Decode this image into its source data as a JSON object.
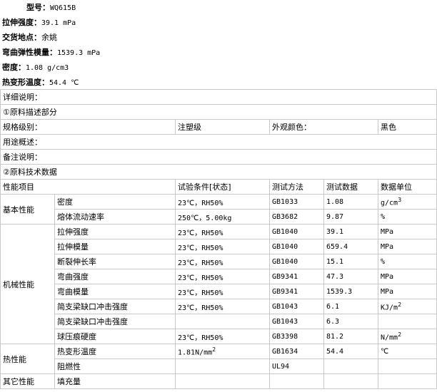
{
  "summary": {
    "model": {
      "label": "型号：",
      "value": "WQ615B"
    },
    "tensile": {
      "label": "拉伸强度：",
      "value": "39.1 mPa"
    },
    "delivery": {
      "label": "交货地点：",
      "value": "余姚"
    },
    "flex_modulus": {
      "label": "弯曲弹性模量：",
      "value": "1539.3 mPa"
    },
    "density": {
      "label": "密度：",
      "value": "1.08 g/cm3"
    },
    "hdt": {
      "label": "热变形温度：",
      "value": "54.4 ℃"
    }
  },
  "details": {
    "heading": "详细说明：",
    "section1": "①原料描述部分",
    "grade_label": "规格级别：",
    "grade_value": "注塑级",
    "color_label": "外观颜色：",
    "color_value": "黑色",
    "usage_label": "用途概述：",
    "note_label": "备注说明：",
    "section2": "②原料技术数据"
  },
  "table": {
    "headers": [
      "性能项目",
      "试验条件[状态]",
      "测试方法",
      "测试数据",
      "数据单位"
    ],
    "groups": [
      {
        "name": "基本性能",
        "rows": [
          {
            "prop": "密度",
            "cond": "23℃，RH50%",
            "method": "GB1033",
            "value": "1.08",
            "unit": "g/cm",
            "sup": "3"
          },
          {
            "prop": "熔体流动速率",
            "cond": "250℃，5.00kg",
            "method": "GB3682",
            "value": "9.87",
            "unit": "%",
            "sup": ""
          }
        ]
      },
      {
        "name": "机械性能",
        "rows": [
          {
            "prop": "拉伸强度",
            "cond": "23℃，RH50%",
            "method": "GB1040",
            "value": "39.1",
            "unit": "MPa",
            "sup": ""
          },
          {
            "prop": "拉伸模量",
            "cond": "23℃，RH50%",
            "method": "GB1040",
            "value": "659.4",
            "unit": "MPa",
            "sup": ""
          },
          {
            "prop": "断裂伸长率",
            "cond": "23℃，RH50%",
            "method": "GB1040",
            "value": "15.1",
            "unit": "%",
            "sup": ""
          },
          {
            "prop": "弯曲强度",
            "cond": "23℃，RH50%",
            "method": "GB9341",
            "value": "47.3",
            "unit": "MPa",
            "sup": ""
          },
          {
            "prop": "弯曲模量",
            "cond": "23℃，RH50%",
            "method": "GB9341",
            "value": "1539.3",
            "unit": "MPa",
            "sup": ""
          },
          {
            "prop": "简支梁缺口冲击强度",
            "cond": "23℃，RH50%",
            "method": "GB1043",
            "value": "6.1",
            "unit": "KJ/m",
            "sup": "2"
          },
          {
            "prop": "简支梁缺口冲击强度",
            "cond": "",
            "method": "GB1043",
            "value": "6.3",
            "unit": "",
            "sup": ""
          },
          {
            "prop": "球压痕硬度",
            "cond": "23℃，RH50%",
            "method": "GB3398",
            "value": "81.2",
            "unit": "N/mm",
            "sup": "2"
          }
        ]
      },
      {
        "name": "热性能",
        "rows": [
          {
            "prop": "热变形温度",
            "cond": "1.81N/mm",
            "cond_sup": "2",
            "method": "GB1634",
            "value": "54.4",
            "unit": "℃",
            "sup": ""
          },
          {
            "prop": "阻燃性",
            "cond": "",
            "method": "UL94",
            "value": "",
            "unit": "",
            "sup": ""
          }
        ]
      },
      {
        "name": "其它性能",
        "rows": [
          {
            "prop": "填充量",
            "cond": "",
            "method": "",
            "value": "",
            "unit": "",
            "sup": ""
          }
        ]
      }
    ]
  }
}
